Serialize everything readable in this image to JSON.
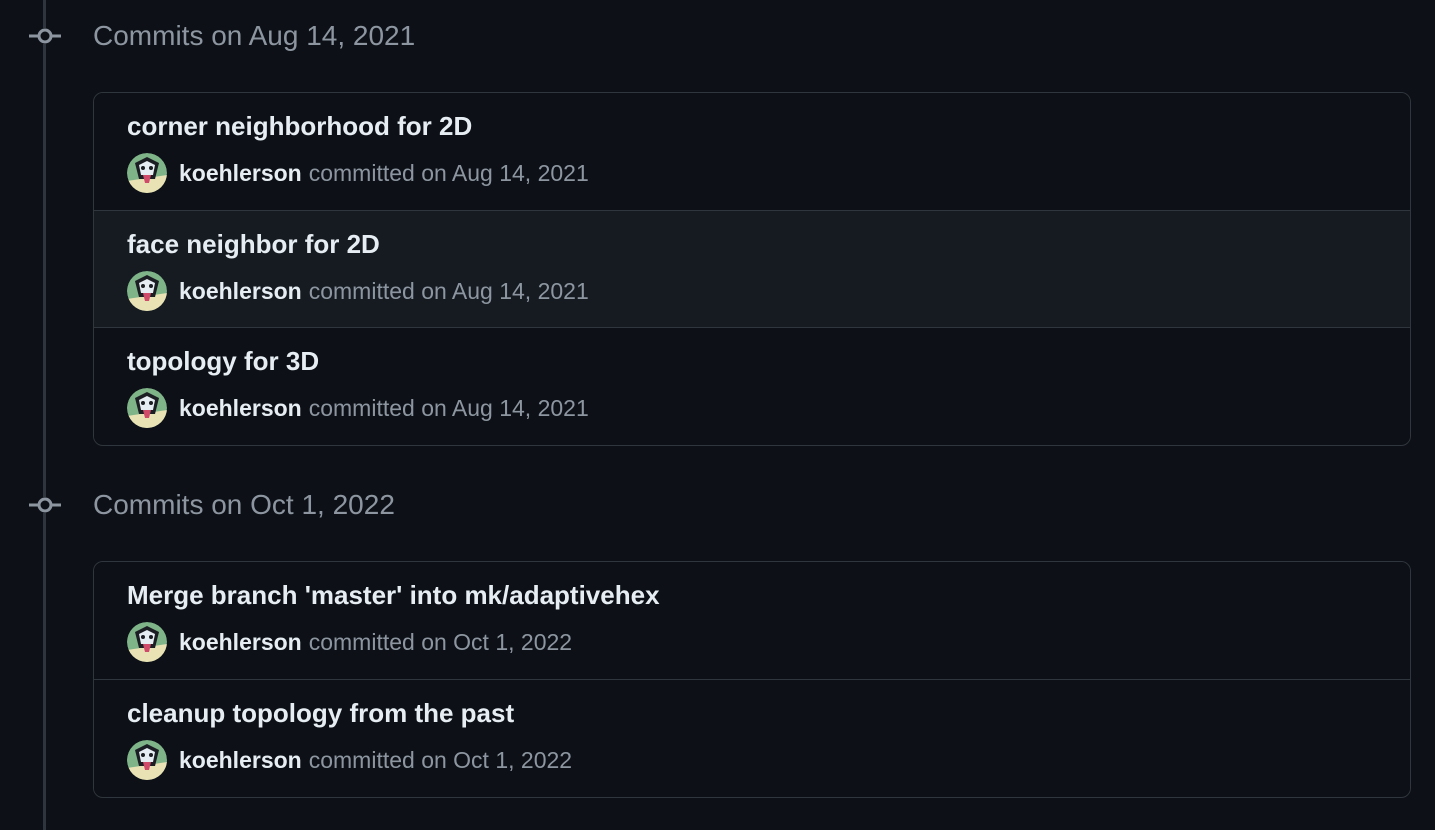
{
  "groups": [
    {
      "title": "Commits on Aug 14, 2021",
      "commits": [
        {
          "message": "corner neighborhood for 2D",
          "author": "koehlerson",
          "committed": "committed on Aug 14, 2021"
        },
        {
          "message": "face neighbor for 2D",
          "author": "koehlerson",
          "committed": "committed on Aug 14, 2021"
        },
        {
          "message": "topology for 3D",
          "author": "koehlerson",
          "committed": "committed on Aug 14, 2021"
        }
      ]
    },
    {
      "title": "Commits on Oct 1, 2022",
      "commits": [
        {
          "message": "Merge branch 'master' into mk/adaptivehex",
          "author": "koehlerson",
          "committed": "committed on Oct 1, 2022"
        },
        {
          "message": "cleanup topology from the past",
          "author": "koehlerson",
          "committed": "committed on Oct 1, 2022"
        }
      ]
    }
  ],
  "icons": {
    "commit_node": "git-commit-icon",
    "avatar": "user-avatar-icon"
  },
  "colors": {
    "background": "#0d1117",
    "row_hover": "#161b22",
    "border": "#30363d",
    "text_primary": "#e6edf3",
    "text_muted": "#8d96a0"
  }
}
